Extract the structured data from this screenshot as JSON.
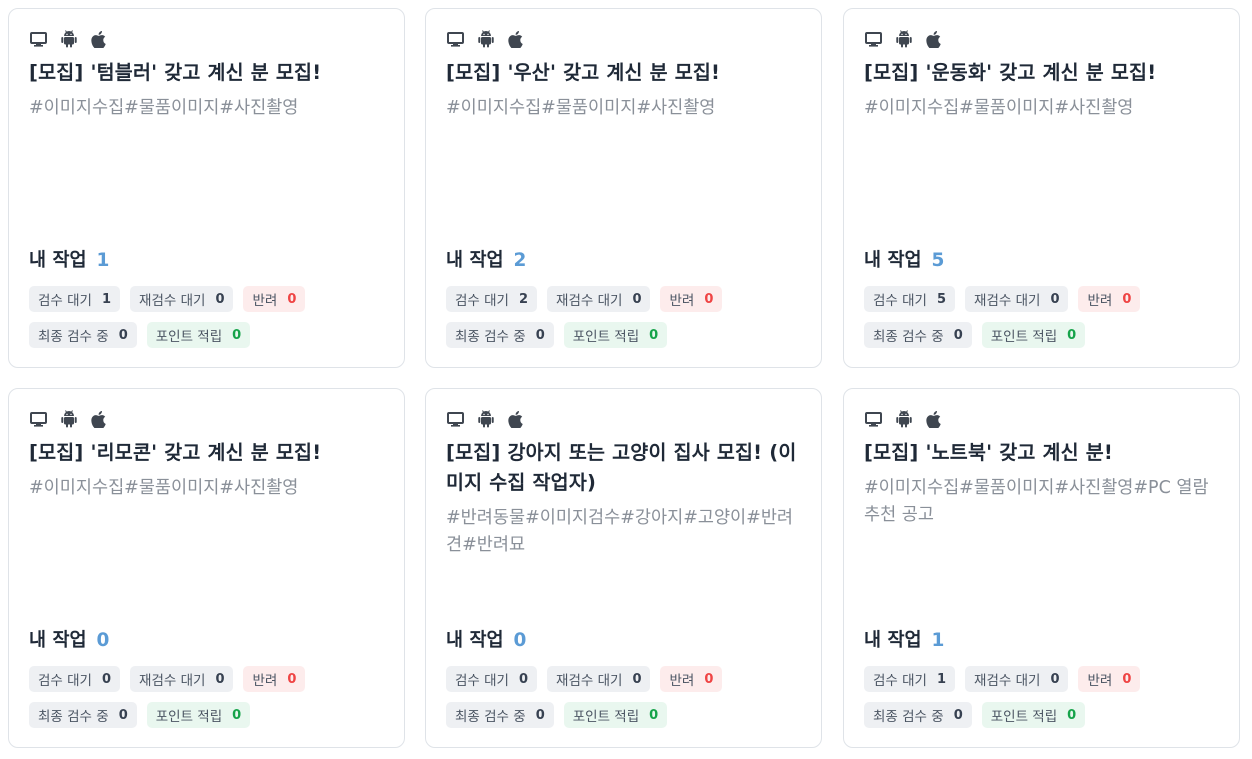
{
  "labels": {
    "my_work": "내 작업",
    "review_wait": "검수 대기",
    "rereview_wait": "재검수 대기",
    "reject": "반려",
    "final_review": "최종 검수 중",
    "points": "포인트 적립"
  },
  "icons": [
    "desktop-icon",
    "android-icon",
    "apple-icon"
  ],
  "colors": {
    "count_blue": "#5b9bd5",
    "reject_red": "#ef4444",
    "point_green": "#16a34a"
  },
  "cards": [
    {
      "title": "[모집] '텀블러' 갖고 계신 분 모집!",
      "tags": "#이미지수집#물품이미지#사진촬영",
      "my_work": "1",
      "review_wait": "1",
      "rereview_wait": "0",
      "reject": "0",
      "final_review": "0",
      "points": "0"
    },
    {
      "title": "[모집] '우산' 갖고 계신 분 모집!",
      "tags": "#이미지수집#물품이미지#사진촬영",
      "my_work": "2",
      "review_wait": "2",
      "rereview_wait": "0",
      "reject": "0",
      "final_review": "0",
      "points": "0"
    },
    {
      "title": "[모집] '운동화' 갖고 계신 분 모집!",
      "tags": "#이미지수집#물품이미지#사진촬영",
      "my_work": "5",
      "review_wait": "5",
      "rereview_wait": "0",
      "reject": "0",
      "final_review": "0",
      "points": "0"
    },
    {
      "title": "[모집] '리모콘' 갖고 계신 분 모집!",
      "tags": "#이미지수집#물품이미지#사진촬영",
      "my_work": "0",
      "review_wait": "0",
      "rereview_wait": "0",
      "reject": "0",
      "final_review": "0",
      "points": "0"
    },
    {
      "title": "[모집] 강아지 또는 고양이 집사 모집! (이미지 수집 작업자)",
      "tags": "#반려동물#이미지검수#강아지#고양이#반려견#반려묘",
      "my_work": "0",
      "review_wait": "0",
      "rereview_wait": "0",
      "reject": "0",
      "final_review": "0",
      "points": "0"
    },
    {
      "title": "[모집] '노트북' 갖고 계신 분!",
      "tags": "#이미지수집#물품이미지#사진촬영#PC 열람 추천 공고",
      "my_work": "1",
      "review_wait": "1",
      "rereview_wait": "0",
      "reject": "0",
      "final_review": "0",
      "points": "0"
    }
  ]
}
